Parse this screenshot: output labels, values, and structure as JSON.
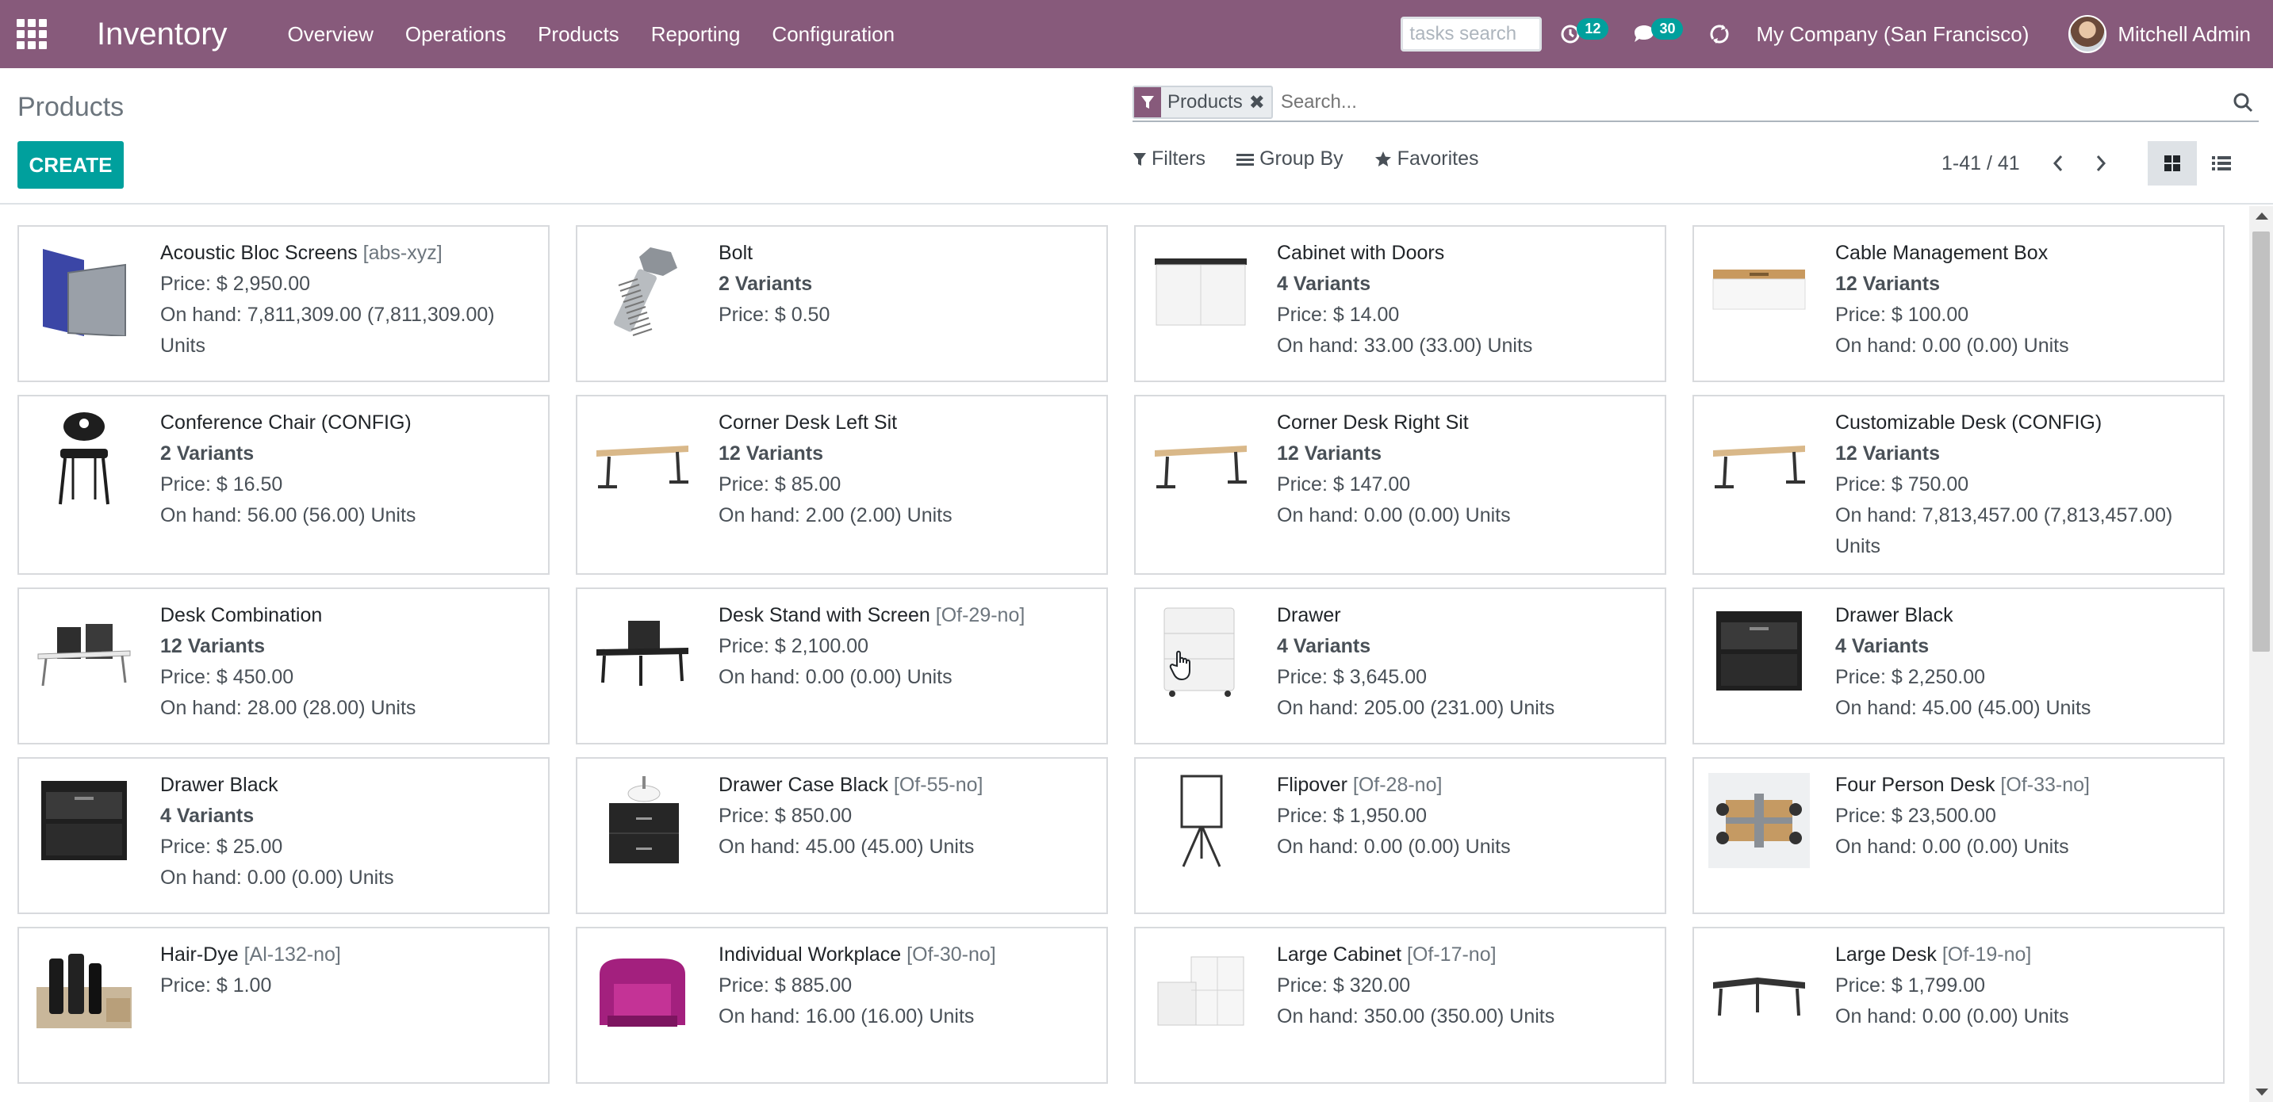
{
  "navbar": {
    "brand": "Inventory",
    "menu": [
      "Overview",
      "Operations",
      "Products",
      "Reporting",
      "Configuration"
    ],
    "tasks_search_placeholder": "tasks search",
    "activity_count": "12",
    "message_count": "30",
    "company": "My Company (San Francisco)",
    "user": "Mitchell Admin",
    "bg_color": "#875a7b"
  },
  "control_panel": {
    "breadcrumb": "Products",
    "create_label": "CREATE",
    "search": {
      "facet_label": "Products",
      "placeholder": "Search..."
    },
    "filters_label": "Filters",
    "group_by_label": "Group By",
    "favorites_label": "Favorites",
    "pager": "1-41 / 41",
    "active_view": "kanban"
  },
  "products": [
    {
      "name": "Acoustic Bloc Screens",
      "ref": "[abs-xyz]",
      "variants": "",
      "price": "Price: $ 2,950.00",
      "onhand": "On hand: 7,811,309.00 (7,811,309.00) Units",
      "icon": "acoustic-screens-image"
    },
    {
      "name": "Bolt",
      "ref": "",
      "variants": "2 Variants",
      "price": "Price: $ 0.50",
      "onhand": "",
      "icon": "bolt-image"
    },
    {
      "name": "Cabinet with Doors",
      "ref": "",
      "variants": "4 Variants",
      "price": "Price: $ 14.00",
      "onhand": "On hand: 33.00 (33.00) Units",
      "icon": "cabinet-image"
    },
    {
      "name": "Cable Management Box",
      "ref": "",
      "variants": "12 Variants",
      "price": "Price: $ 100.00",
      "onhand": "On hand: 0.00 (0.00) Units",
      "icon": "cable-box-image"
    },
    {
      "name": "Conference Chair (CONFIG)",
      "ref": "",
      "variants": "2 Variants",
      "price": "Price: $ 16.50",
      "onhand": "On hand: 56.00 (56.00) Units",
      "icon": "chair-image"
    },
    {
      "name": "Corner Desk Left Sit",
      "ref": "",
      "variants": "12 Variants",
      "price": "Price: $ 85.00",
      "onhand": "On hand: 2.00 (2.00) Units",
      "icon": "desk-image"
    },
    {
      "name": "Corner Desk Right Sit",
      "ref": "",
      "variants": "12 Variants",
      "price": "Price: $ 147.00",
      "onhand": "On hand: 0.00 (0.00) Units",
      "icon": "desk-image"
    },
    {
      "name": "Customizable Desk (CONFIG)",
      "ref": "",
      "variants": "12 Variants",
      "price": "Price: $ 750.00",
      "onhand": "On hand: 7,813,457.00 (7,813,457.00) Units",
      "icon": "desk-image"
    },
    {
      "name": "Desk Combination",
      "ref": "",
      "variants": "12 Variants",
      "price": "Price: $ 450.00",
      "onhand": "On hand: 28.00 (28.00) Units",
      "icon": "desk-combination-image"
    },
    {
      "name": "Desk Stand with Screen",
      "ref": "[Of-29-no]",
      "variants": "",
      "price": "Price: $ 2,100.00",
      "onhand": "On hand: 0.00 (0.00) Units",
      "icon": "desk-screen-image"
    },
    {
      "name": "Drawer",
      "ref": "",
      "variants": "4 Variants",
      "price": "Price: $ 3,645.00",
      "onhand": "On hand: 205.00 (231.00) Units",
      "icon": "drawer-white-image"
    },
    {
      "name": "Drawer Black",
      "ref": "",
      "variants": "4 Variants",
      "price": "Price: $ 2,250.00",
      "onhand": "On hand: 45.00 (45.00) Units",
      "icon": "drawer-black-image"
    },
    {
      "name": "Drawer Black",
      "ref": "",
      "variants": "4 Variants",
      "price": "Price: $ 25.00",
      "onhand": "On hand: 0.00 (0.00) Units",
      "icon": "drawer-black-image"
    },
    {
      "name": "Drawer Case Black",
      "ref": "[Of-55-no]",
      "variants": "",
      "price": "Price: $ 850.00",
      "onhand": "On hand: 45.00 (45.00) Units",
      "icon": "drawer-case-image"
    },
    {
      "name": "Flipover",
      "ref": "[Of-28-no]",
      "variants": "",
      "price": "Price: $ 1,950.00",
      "onhand": "On hand: 0.00 (0.00) Units",
      "icon": "flipover-image"
    },
    {
      "name": "Four Person Desk",
      "ref": "[Of-33-no]",
      "variants": "",
      "price": "Price: $ 23,500.00",
      "onhand": "On hand: 0.00 (0.00) Units",
      "icon": "four-person-desk-image"
    },
    {
      "name": "Hair-Dye",
      "ref": "[Al-132-no]",
      "variants": "",
      "price": "Price: $ 1.00",
      "onhand": "",
      "icon": "hair-dye-image"
    },
    {
      "name": "Individual Workplace",
      "ref": "[Of-30-no]",
      "variants": "",
      "price": "Price: $ 885.00",
      "onhand": "On hand: 16.00 (16.00) Units",
      "icon": "workplace-image"
    },
    {
      "name": "Large Cabinet",
      "ref": "[Of-17-no]",
      "variants": "",
      "price": "Price: $ 320.00",
      "onhand": "On hand: 350.00 (350.00) Units",
      "icon": "large-cabinet-image"
    },
    {
      "name": "Large Desk",
      "ref": "[Of-19-no]",
      "variants": "",
      "price": "Price: $ 1,799.00",
      "onhand": "On hand: 0.00 (0.00) Units",
      "icon": "large-desk-image"
    }
  ]
}
